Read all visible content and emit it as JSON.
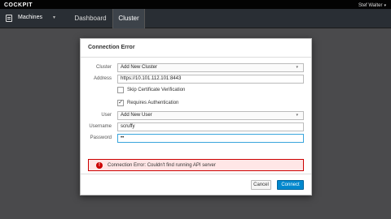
{
  "header": {
    "brand": "COCKPIT",
    "user": "Stef Walter",
    "user_caret": "▾"
  },
  "nav": {
    "machines_label": "Machines",
    "machines_arrow": "▾",
    "tabs": [
      {
        "label": "Dashboard"
      },
      {
        "label": "Cluster",
        "active": true
      }
    ]
  },
  "dialog": {
    "title": "Connection Error",
    "cluster_label": "Cluster",
    "cluster_value": "Add New Cluster",
    "address_label": "Address",
    "address_value": "https://10.101.112.101:8443",
    "skip_verification_label": "Skip Certificate Verification",
    "skip_verification_checked": false,
    "requires_auth_label": "Requires Authentication",
    "requires_auth_checked": true,
    "check_mark": "✓",
    "user_label": "User",
    "user_value": "Add New User",
    "username_label": "Username",
    "username_value": "scruffy",
    "password_label": "Password",
    "password_value": "••",
    "dropdown_arrow": "▾",
    "alert_icon": "!",
    "alert_text": "Connection Error: Couldn't find running API server",
    "cancel_label": "Cancel",
    "connect_label": "Connect"
  },
  "colors": {
    "primary": "#0088ce",
    "error": "#cc0000",
    "error_bg": "#ffe6e6"
  }
}
